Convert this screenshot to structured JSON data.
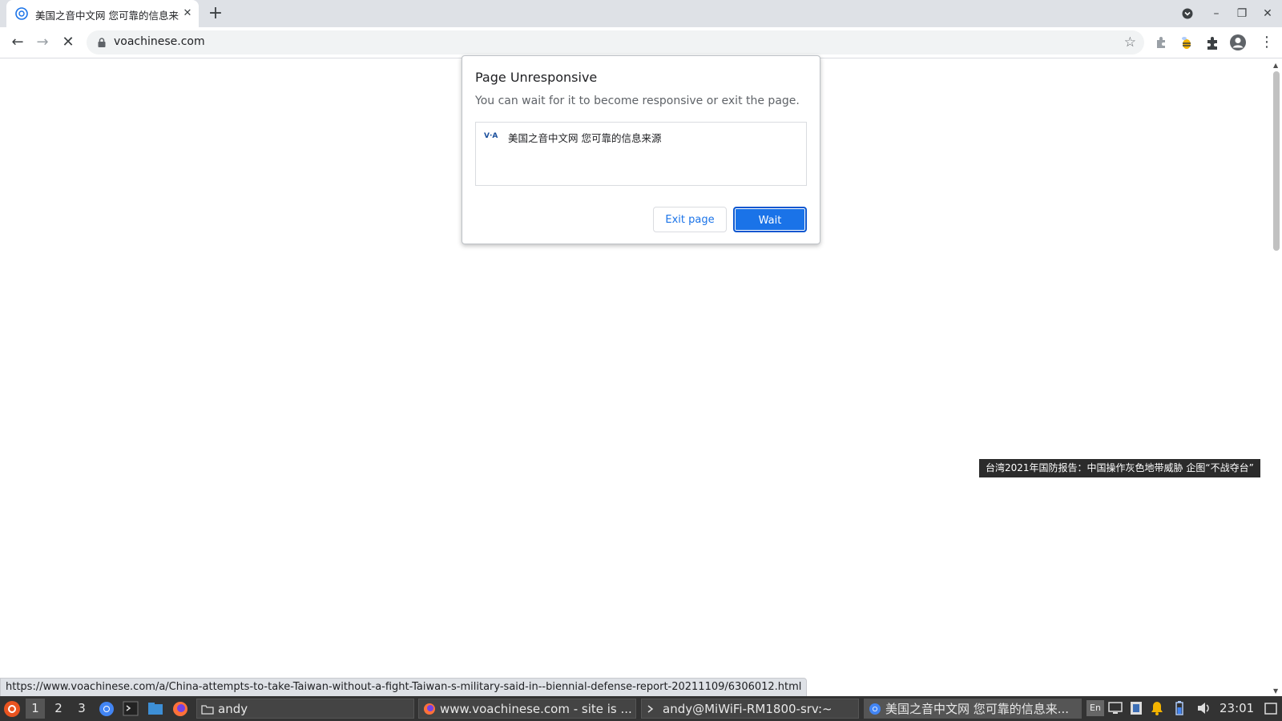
{
  "browser": {
    "tab_title": "美国之音中文网 您可靠的信息来源",
    "url": "voachinese.com",
    "status_url": "https://www.voachinese.com/a/China-attempts-to-take-Taiwan-without-a-fight-Taiwan-s-military-said-in--biennial-defense-report-20211109/6306012.html"
  },
  "page": {
    "headline_tooltip": "台湾2021年国防报告：中国操作灰色地带威胁 企图“不战夺台”"
  },
  "dialog": {
    "title": "Page Unresponsive",
    "body": "You can wait for it to become responsive or exit the page.",
    "item_label": "美国之音中文网 您可靠的信息来源",
    "item_icon_text": "V·A",
    "exit_label": "Exit page",
    "wait_label": "Wait",
    "accent": "#1a73e8"
  },
  "taskbar": {
    "workspaces": [
      "1",
      "2",
      "3"
    ],
    "tasks": [
      {
        "label": "andy",
        "icon": "folder-icon"
      },
      {
        "label": "www.voachinese.com - site is ...",
        "icon": "firefox-icon"
      },
      {
        "label": "andy@MiWiFi-RM1800-srv:~",
        "icon": "terminal-icon"
      },
      {
        "label": "美国之音中文网 您可靠的信息来...",
        "icon": "chrome-icon"
      }
    ],
    "clock": "23:01",
    "keyboard_layout": "En"
  }
}
